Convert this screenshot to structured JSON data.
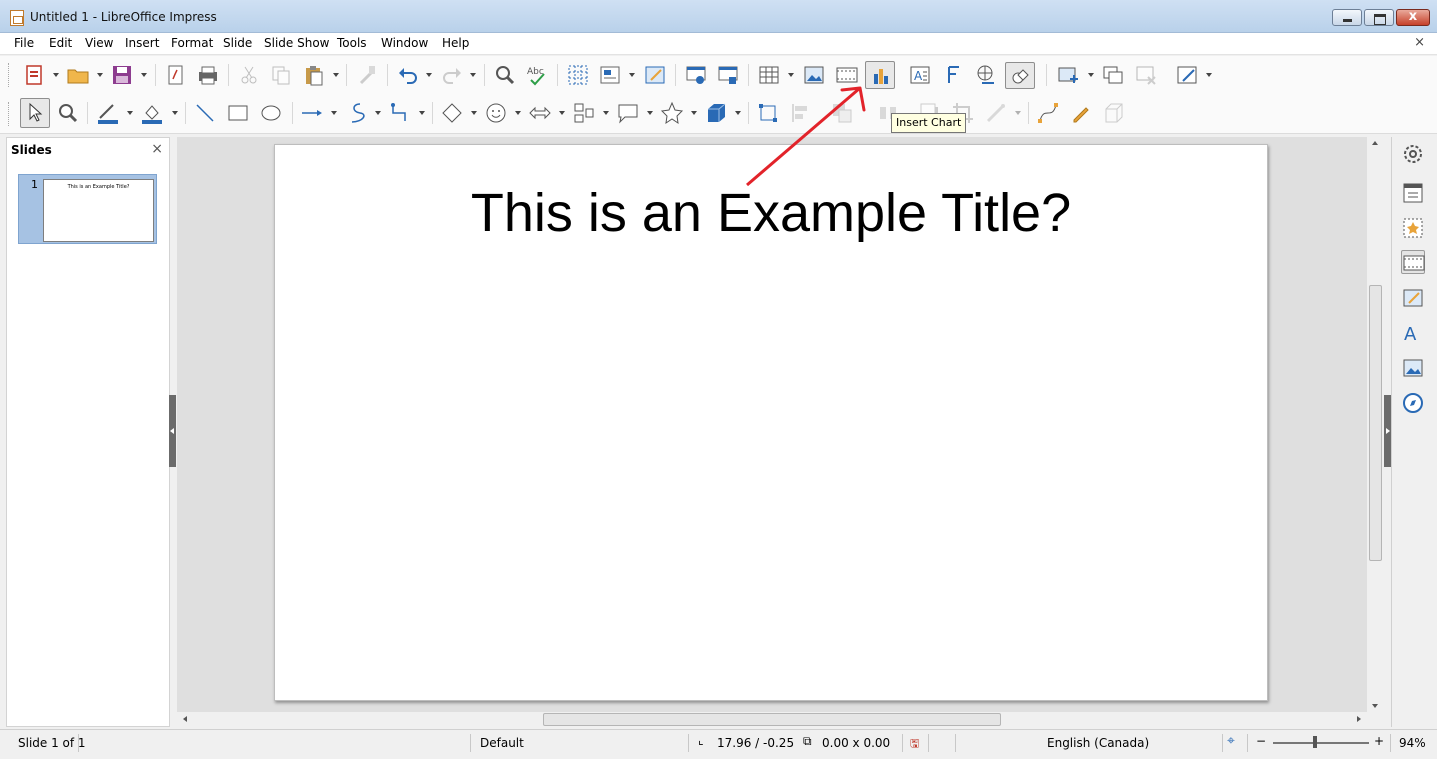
{
  "window": {
    "title": "Untitled 1 - LibreOffice Impress",
    "close_glyph": "x"
  },
  "menu": [
    "File",
    "Edit",
    "View",
    "Insert",
    "Format",
    "Slide",
    "Slide Show",
    "Tools",
    "Window",
    "Help"
  ],
  "document_close_glyph": "×",
  "tooltip": {
    "text": "Insert Chart"
  },
  "slides_pane": {
    "title": "Slides",
    "close_glyph": "×",
    "slides": [
      {
        "number": "1",
        "title": "This is an Example Title?"
      }
    ]
  },
  "slide": {
    "title": "This is an Example Title?"
  },
  "statusbar": {
    "slide_position": "Slide 1 of 1",
    "master": "Default",
    "position": "17.96 / -0.25",
    "size": "0.00 x 0.00",
    "language": "English (Canada)",
    "zoom": "94%",
    "zoom_minus": "−",
    "zoom_plus": "+"
  },
  "colors": {
    "accent_blue": "#2a6ab5",
    "chart_orange": "#e8a33a",
    "annotation_red": "#e2232a",
    "title_bar": "#c4d9f0"
  }
}
